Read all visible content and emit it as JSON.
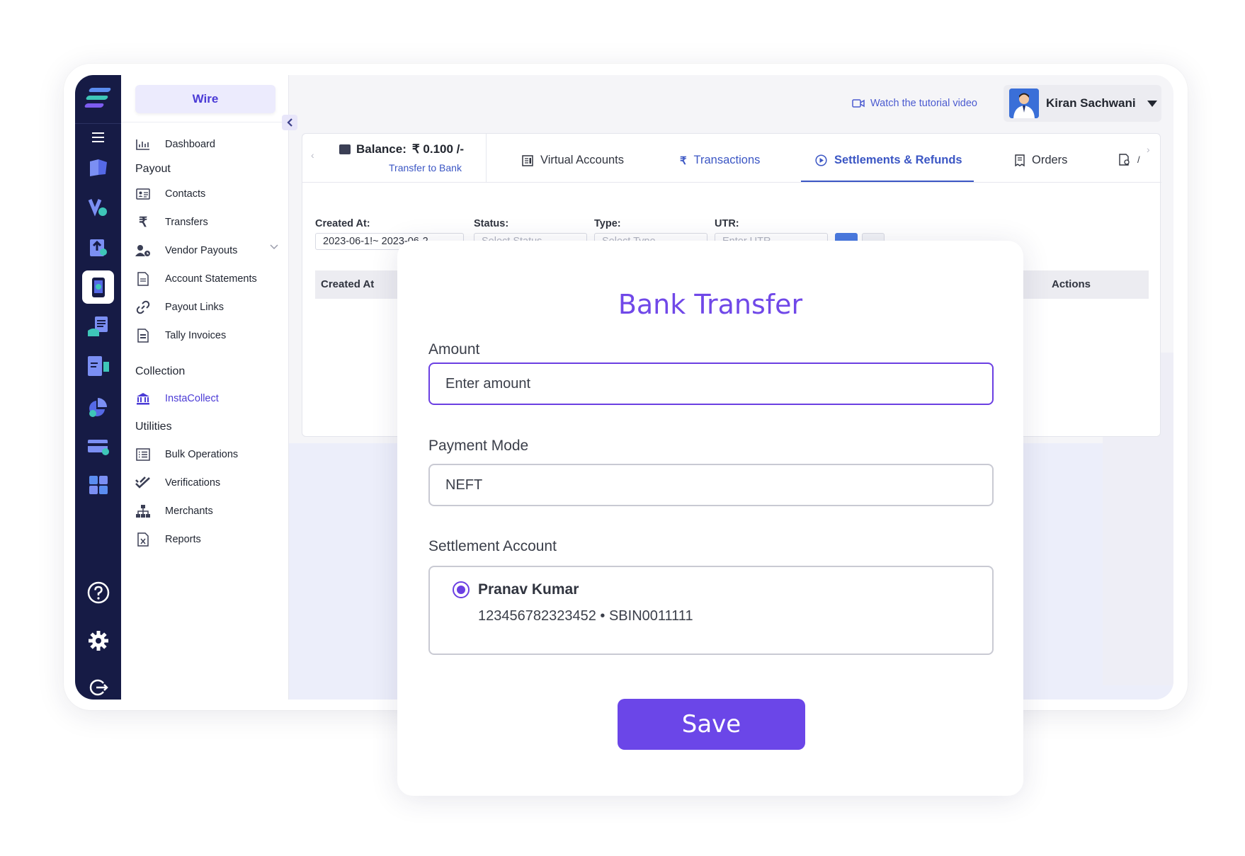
{
  "brand": {
    "label": "Wire"
  },
  "nav": {
    "dashboard": "Dashboard",
    "payout_section": "Payout",
    "contacts": "Contacts",
    "transfers": "Transfers",
    "vendor_payouts": "Vendor Payouts",
    "account_statements": "Account Statements",
    "payout_links": "Payout Links",
    "tally_invoices": "Tally Invoices",
    "collection_section": "Collection",
    "instacollect": "InstaCollect",
    "utilities_section": "Utilities",
    "bulk_operations": "Bulk Operations",
    "verifications": "Verifications",
    "merchants": "Merchants",
    "reports": "Reports"
  },
  "header": {
    "tutorial_link": "Watch the tutorial video",
    "user_name": "Kiran Sachwani"
  },
  "balance": {
    "label": "Balance:",
    "amount": "₹ 0.100 /-",
    "transfer_link": "Transfer to Bank"
  },
  "tabs": {
    "virtual_accounts": "Virtual Accounts",
    "transactions": "Transactions",
    "settlements_refunds": "Settlements & Refunds",
    "orders": "Orders",
    "truncated": "/"
  },
  "filters": {
    "created_at_label": "Created At:",
    "created_at_value": "2023-06-1!~ 2023-06-2",
    "status_label": "Status:",
    "status_placeholder": "Select Status",
    "type_label": "Type:",
    "type_placeholder": "Select Type",
    "utr_label": "UTR:",
    "utr_placeholder": "Enter UTR"
  },
  "table": {
    "col_created_at": "Created At",
    "col_actions": "Actions"
  },
  "modal": {
    "title": "Bank Transfer",
    "amount_label": "Amount",
    "amount_placeholder": "Enter amount",
    "payment_mode_label": "Payment Mode",
    "payment_mode_value": "NEFT",
    "settlement_account_label": "Settlement Account",
    "account_name": "Pranav Kumar",
    "account_details": "123456782323452 • SBIN0011111",
    "save_label": "Save"
  },
  "colors": {
    "accent_purple": "#6b46e8",
    "rail_navy": "#161b45",
    "link_blue": "#3b56c4"
  }
}
